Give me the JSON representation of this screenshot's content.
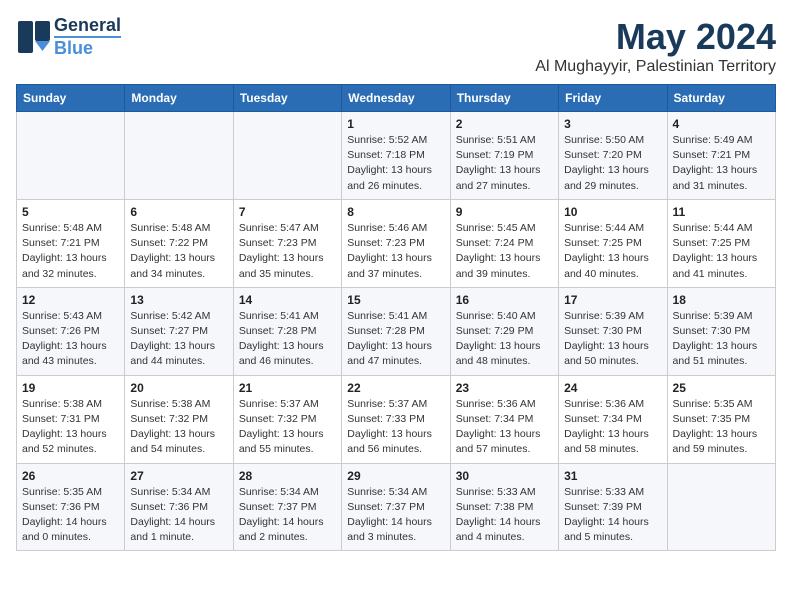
{
  "logo": {
    "line1": "General",
    "line2": "Blue"
  },
  "title": "May 2024",
  "subtitle": "Al Mughayyir, Palestinian Territory",
  "days_header": [
    "Sunday",
    "Monday",
    "Tuesday",
    "Wednesday",
    "Thursday",
    "Friday",
    "Saturday"
  ],
  "weeks": [
    [
      {
        "num": "",
        "info": ""
      },
      {
        "num": "",
        "info": ""
      },
      {
        "num": "",
        "info": ""
      },
      {
        "num": "1",
        "info": "Sunrise: 5:52 AM\nSunset: 7:18 PM\nDaylight: 13 hours\nand 26 minutes."
      },
      {
        "num": "2",
        "info": "Sunrise: 5:51 AM\nSunset: 7:19 PM\nDaylight: 13 hours\nand 27 minutes."
      },
      {
        "num": "3",
        "info": "Sunrise: 5:50 AM\nSunset: 7:20 PM\nDaylight: 13 hours\nand 29 minutes."
      },
      {
        "num": "4",
        "info": "Sunrise: 5:49 AM\nSunset: 7:21 PM\nDaylight: 13 hours\nand 31 minutes."
      }
    ],
    [
      {
        "num": "5",
        "info": "Sunrise: 5:48 AM\nSunset: 7:21 PM\nDaylight: 13 hours\nand 32 minutes."
      },
      {
        "num": "6",
        "info": "Sunrise: 5:48 AM\nSunset: 7:22 PM\nDaylight: 13 hours\nand 34 minutes."
      },
      {
        "num": "7",
        "info": "Sunrise: 5:47 AM\nSunset: 7:23 PM\nDaylight: 13 hours\nand 35 minutes."
      },
      {
        "num": "8",
        "info": "Sunrise: 5:46 AM\nSunset: 7:23 PM\nDaylight: 13 hours\nand 37 minutes."
      },
      {
        "num": "9",
        "info": "Sunrise: 5:45 AM\nSunset: 7:24 PM\nDaylight: 13 hours\nand 39 minutes."
      },
      {
        "num": "10",
        "info": "Sunrise: 5:44 AM\nSunset: 7:25 PM\nDaylight: 13 hours\nand 40 minutes."
      },
      {
        "num": "11",
        "info": "Sunrise: 5:44 AM\nSunset: 7:25 PM\nDaylight: 13 hours\nand 41 minutes."
      }
    ],
    [
      {
        "num": "12",
        "info": "Sunrise: 5:43 AM\nSunset: 7:26 PM\nDaylight: 13 hours\nand 43 minutes."
      },
      {
        "num": "13",
        "info": "Sunrise: 5:42 AM\nSunset: 7:27 PM\nDaylight: 13 hours\nand 44 minutes."
      },
      {
        "num": "14",
        "info": "Sunrise: 5:41 AM\nSunset: 7:28 PM\nDaylight: 13 hours\nand 46 minutes."
      },
      {
        "num": "15",
        "info": "Sunrise: 5:41 AM\nSunset: 7:28 PM\nDaylight: 13 hours\nand 47 minutes."
      },
      {
        "num": "16",
        "info": "Sunrise: 5:40 AM\nSunset: 7:29 PM\nDaylight: 13 hours\nand 48 minutes."
      },
      {
        "num": "17",
        "info": "Sunrise: 5:39 AM\nSunset: 7:30 PM\nDaylight: 13 hours\nand 50 minutes."
      },
      {
        "num": "18",
        "info": "Sunrise: 5:39 AM\nSunset: 7:30 PM\nDaylight: 13 hours\nand 51 minutes."
      }
    ],
    [
      {
        "num": "19",
        "info": "Sunrise: 5:38 AM\nSunset: 7:31 PM\nDaylight: 13 hours\nand 52 minutes."
      },
      {
        "num": "20",
        "info": "Sunrise: 5:38 AM\nSunset: 7:32 PM\nDaylight: 13 hours\nand 54 minutes."
      },
      {
        "num": "21",
        "info": "Sunrise: 5:37 AM\nSunset: 7:32 PM\nDaylight: 13 hours\nand 55 minutes."
      },
      {
        "num": "22",
        "info": "Sunrise: 5:37 AM\nSunset: 7:33 PM\nDaylight: 13 hours\nand 56 minutes."
      },
      {
        "num": "23",
        "info": "Sunrise: 5:36 AM\nSunset: 7:34 PM\nDaylight: 13 hours\nand 57 minutes."
      },
      {
        "num": "24",
        "info": "Sunrise: 5:36 AM\nSunset: 7:34 PM\nDaylight: 13 hours\nand 58 minutes."
      },
      {
        "num": "25",
        "info": "Sunrise: 5:35 AM\nSunset: 7:35 PM\nDaylight: 13 hours\nand 59 minutes."
      }
    ],
    [
      {
        "num": "26",
        "info": "Sunrise: 5:35 AM\nSunset: 7:36 PM\nDaylight: 14 hours\nand 0 minutes."
      },
      {
        "num": "27",
        "info": "Sunrise: 5:34 AM\nSunset: 7:36 PM\nDaylight: 14 hours\nand 1 minute."
      },
      {
        "num": "28",
        "info": "Sunrise: 5:34 AM\nSunset: 7:37 PM\nDaylight: 14 hours\nand 2 minutes."
      },
      {
        "num": "29",
        "info": "Sunrise: 5:34 AM\nSunset: 7:37 PM\nDaylight: 14 hours\nand 3 minutes."
      },
      {
        "num": "30",
        "info": "Sunrise: 5:33 AM\nSunset: 7:38 PM\nDaylight: 14 hours\nand 4 minutes."
      },
      {
        "num": "31",
        "info": "Sunrise: 5:33 AM\nSunset: 7:39 PM\nDaylight: 14 hours\nand 5 minutes."
      },
      {
        "num": "",
        "info": ""
      }
    ]
  ]
}
